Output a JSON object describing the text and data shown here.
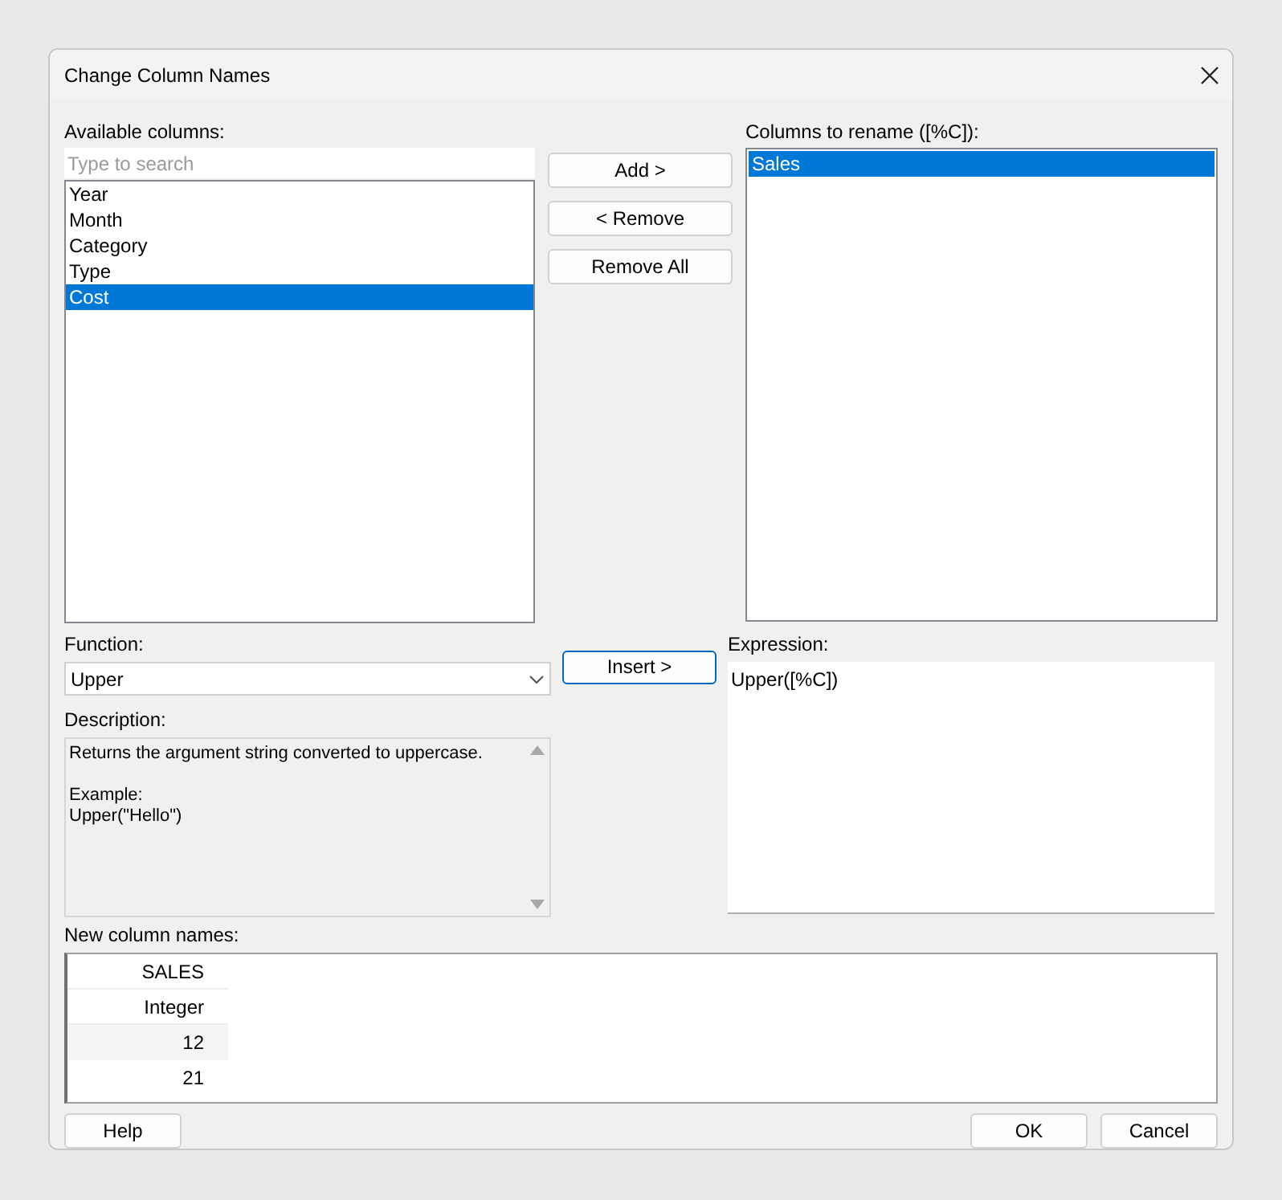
{
  "window": {
    "title": "Change Column Names"
  },
  "available": {
    "label": "Available columns:",
    "placeholder": "Type to search",
    "items": [
      {
        "label": "Year",
        "selected": false
      },
      {
        "label": "Month",
        "selected": false
      },
      {
        "label": "Category",
        "selected": false
      },
      {
        "label": "Type",
        "selected": false
      },
      {
        "label": "Cost",
        "selected": true
      }
    ]
  },
  "move_buttons": [
    "Add >",
    "< Remove",
    "Remove All"
  ],
  "rename": {
    "label": "Columns to rename ([%C]):",
    "items": [
      {
        "label": "Sales",
        "selected": true
      }
    ]
  },
  "function": {
    "label": "Function:",
    "value": "Upper"
  },
  "insert_button": "Insert >",
  "expression": {
    "label": "Expression:",
    "value": "Upper([%C])"
  },
  "description": {
    "label": "Description:",
    "paragraphs": [
      [
        "Returns the argument string converted to uppercase."
      ],
      [
        "Example:",
        "Upper(\"Hello\")"
      ]
    ]
  },
  "preview": {
    "label": "New column names:",
    "column": {
      "header": "SALES",
      "type": "Integer",
      "values": [
        "12",
        "21"
      ]
    }
  },
  "buttons": {
    "help": "Help",
    "ok": "OK",
    "cancel": "Cancel"
  }
}
